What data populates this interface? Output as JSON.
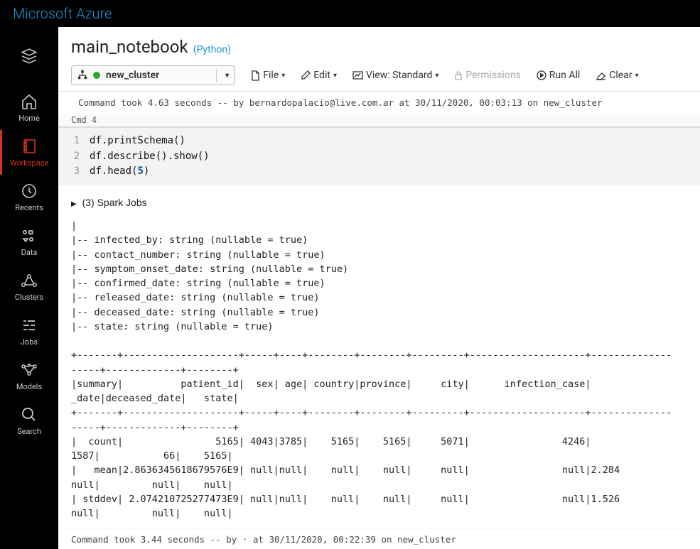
{
  "header": {
    "brand": "Microsoft Azure"
  },
  "sidebar": {
    "items": [
      {
        "key": "logo",
        "label": ""
      },
      {
        "key": "home",
        "label": "Home"
      },
      {
        "key": "workspace",
        "label": "Workspace"
      },
      {
        "key": "recents",
        "label": "Recents"
      },
      {
        "key": "data",
        "label": "Data"
      },
      {
        "key": "clusters",
        "label": "Clusters"
      },
      {
        "key": "jobs",
        "label": "Jobs"
      },
      {
        "key": "models",
        "label": "Models"
      },
      {
        "key": "search",
        "label": "Search"
      }
    ]
  },
  "notebook": {
    "title": "main_notebook",
    "language": "(Python)"
  },
  "toolbar": {
    "cluster": "new_cluster",
    "file": "File",
    "edit": "Edit",
    "view": "View: Standard",
    "permissions": "Permissions",
    "run_all": "Run All",
    "clear": "Clear"
  },
  "cmd3": {
    "status": "Command took 4.63 seconds -- by bernardopalacio@live.com.ar at 30/11/2020, 00:03:13 on new_cluster"
  },
  "cmd4": {
    "label": "Cmd 4",
    "code": {
      "l1": "df.printSchema()",
      "l2": "df.describe().show()",
      "l3a": "df.head(",
      "l3num": "5",
      "l3b": ")"
    },
    "spark_jobs": "(3) Spark Jobs",
    "output": "|\n|-- infected_by: string (nullable = true)\n|-- contact_number: string (nullable = true)\n|-- symptom_onset_date: string (nullable = true)\n|-- confirmed_date: string (nullable = true)\n|-- released_date: string (nullable = true)\n|-- deceased_date: string (nullable = true)\n|-- state: string (nullable = true)\n\n+-------+--------------------+-----+----+--------+--------+---------+--------------------+--------------\n-----+-------------+--------+\n|summary|          patient_id|  sex| age| country|province|     city|      infection_case|\n_date|deceased_date|   state|\n+-------+--------------------+-----+----+--------+--------+---------+--------------------+--------------\n-----+-------------+--------+\n|  count|                5165| 4043|3785|    5165|    5165|     5071|                4246|\n1587|           66|    5165|\n|   mean|2.8636345618679576E9| null|null|    null|    null|     null|                null|2.284\nnull|         null|    null|\n| stddev| 2.074210725277473E9| null|null|    null|    null|     null|                null|1.526\nnull|         null|    null|",
    "status": "Command took 3.44 seconds -- by                        · at 30/11/2020, 00:22:39 on new_cluster"
  }
}
